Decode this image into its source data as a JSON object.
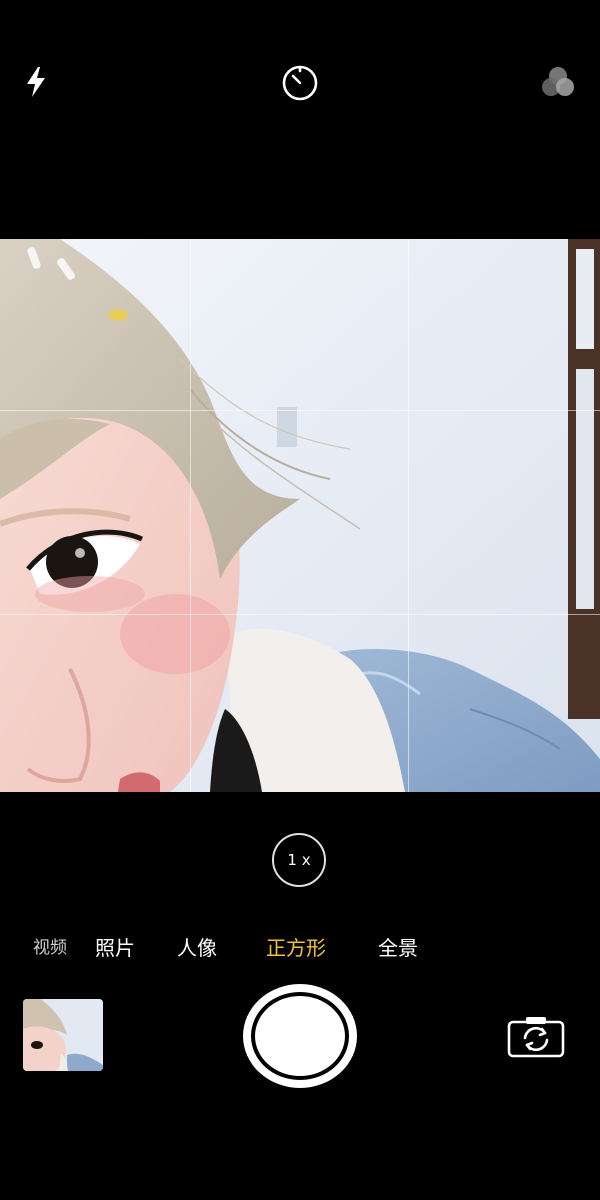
{
  "top_bar": {
    "flash": {
      "icon": "flash-icon"
    },
    "timer": {
      "icon": "timer-icon"
    },
    "filters": {
      "icon": "filters-icon"
    }
  },
  "viewfinder": {
    "grid": "rule-of-thirds",
    "scene": "selfie-preview"
  },
  "zoom": {
    "label": "1 x"
  },
  "modes": {
    "items": [
      {
        "label": "视频"
      },
      {
        "label": "照片"
      },
      {
        "label": "人像"
      },
      {
        "label": "正方形"
      },
      {
        "label": "全景"
      }
    ],
    "selected": "正方形",
    "selected_color": "#f3c13a"
  },
  "bottom_bar": {
    "thumbnail": {
      "icon": "last-photo-thumbnail"
    },
    "shutter": {
      "icon": "shutter-icon"
    },
    "switch_camera": {
      "icon": "switch-camera-icon"
    }
  }
}
